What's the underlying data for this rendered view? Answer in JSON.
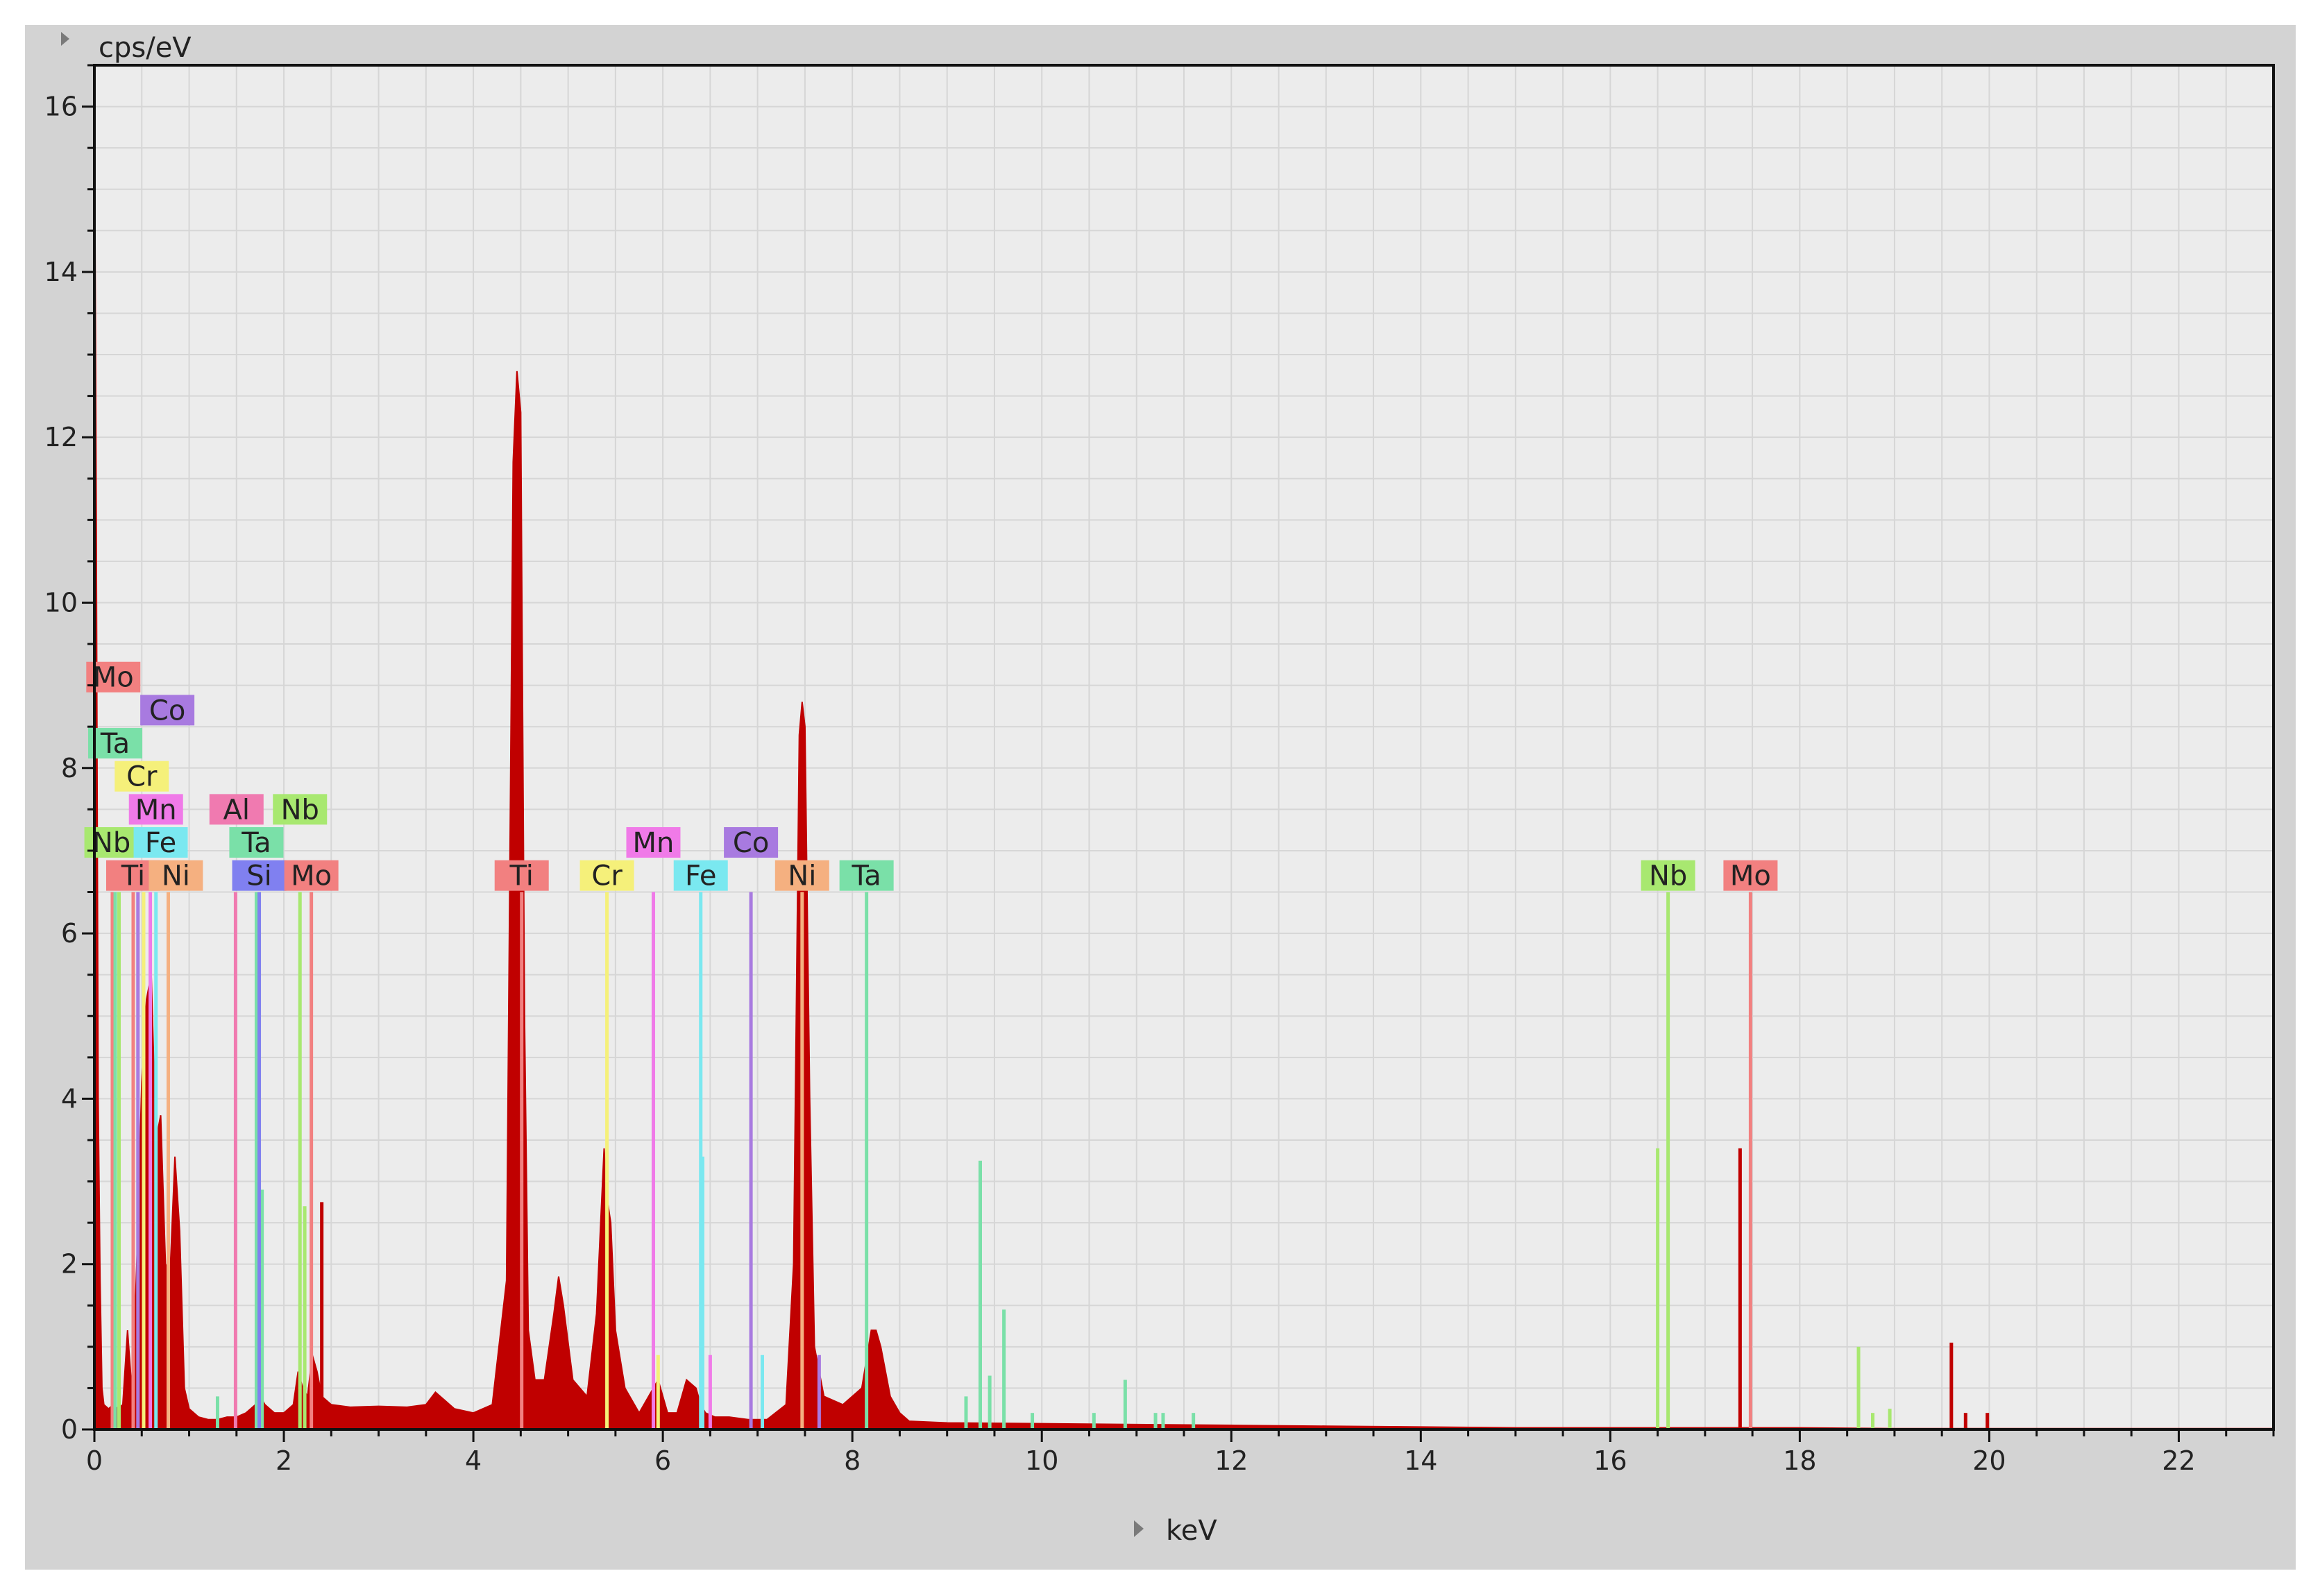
{
  "chart_data": {
    "type": "line",
    "title": "",
    "xlabel": "keV",
    "ylabel": "cps/eV",
    "xlim": [
      0,
      23
    ],
    "ylim": [
      0,
      16.5
    ],
    "x_ticks": [
      0,
      2,
      4,
      6,
      8,
      10,
      12,
      14,
      16,
      18,
      20,
      22
    ],
    "y_ticks": [
      0,
      2,
      4,
      6,
      8,
      10,
      12,
      14,
      16
    ],
    "grid": true,
    "colors": {
      "spectrum": "#c00000",
      "plot_bg": "#ececec",
      "frame_bg": "#d3d3d3",
      "grid": "#d6d6d6"
    },
    "series": [
      {
        "kind": "spectrum",
        "x": [
          0.0,
          0.02,
          0.04,
          0.06,
          0.08,
          0.1,
          0.15,
          0.2,
          0.25,
          0.3,
          0.35,
          0.4,
          0.45,
          0.5,
          0.55,
          0.6,
          0.65,
          0.7,
          0.75,
          0.8,
          0.85,
          0.9,
          0.95,
          1.0,
          1.1,
          1.2,
          1.3,
          1.4,
          1.5,
          1.6,
          1.7,
          1.75,
          1.8,
          1.9,
          2.0,
          2.1,
          2.15,
          2.2,
          2.25,
          2.3,
          2.35,
          2.4,
          2.5,
          2.7,
          3.0,
          3.3,
          3.5,
          3.6,
          3.7,
          3.8,
          4.0,
          4.2,
          4.35,
          4.42,
          4.46,
          4.5,
          4.54,
          4.58,
          4.65,
          4.75,
          4.85,
          4.9,
          4.95,
          5.05,
          5.2,
          5.3,
          5.38,
          5.41,
          5.45,
          5.5,
          5.6,
          5.75,
          5.85,
          5.95,
          6.05,
          6.15,
          6.25,
          6.35,
          6.4,
          6.45,
          6.55,
          6.7,
          6.9,
          7.1,
          7.3,
          7.38,
          7.44,
          7.47,
          7.5,
          7.55,
          7.6,
          7.7,
          7.9,
          8.1,
          8.2,
          8.25,
          8.3,
          8.4,
          8.5,
          8.6,
          9.0,
          10.0,
          11.0,
          12.0,
          13.0,
          14.0,
          15.0,
          16.0,
          17.0,
          18.0,
          19.0,
          20.0,
          21.0,
          22.0,
          23.0
        ],
        "y": [
          16.3,
          11.0,
          4.0,
          1.8,
          0.5,
          0.3,
          0.25,
          0.3,
          0.25,
          0.3,
          1.2,
          0.4,
          2.1,
          4.2,
          5.2,
          5.5,
          3.5,
          3.8,
          2.0,
          1.9,
          3.3,
          2.4,
          0.5,
          0.25,
          0.15,
          0.12,
          0.12,
          0.15,
          0.15,
          0.2,
          0.3,
          0.4,
          0.3,
          0.2,
          0.2,
          0.3,
          0.7,
          0.5,
          0.4,
          0.9,
          0.7,
          0.4,
          0.3,
          0.27,
          0.28,
          0.27,
          0.3,
          0.45,
          0.35,
          0.25,
          0.2,
          0.3,
          1.8,
          11.7,
          12.8,
          12.3,
          5.0,
          1.2,
          0.6,
          0.6,
          1.4,
          1.85,
          1.5,
          0.6,
          0.4,
          1.4,
          3.4,
          2.8,
          2.5,
          1.2,
          0.5,
          0.2,
          0.4,
          0.6,
          0.2,
          0.2,
          0.6,
          0.5,
          0.3,
          0.2,
          0.15,
          0.15,
          0.12,
          0.12,
          0.3,
          2.0,
          8.4,
          8.8,
          8.5,
          4.0,
          1.0,
          0.4,
          0.3,
          0.5,
          1.2,
          1.2,
          1.0,
          0.4,
          0.2,
          0.1,
          0.08,
          0.07,
          0.06,
          0.05,
          0.04,
          0.03,
          0.02,
          0.02,
          0.02,
          0.02,
          0.01,
          0.01,
          0.01,
          0.01,
          0.01
        ]
      }
    ],
    "element_markers": [
      {
        "label": "Mo",
        "x": 0.19,
        "height": 6.5,
        "row": 0,
        "color": "#f28080"
      },
      {
        "label": "Ta",
        "x": 0.22,
        "height": 6.5,
        "row": 0,
        "color": "#7ae0a8"
      },
      {
        "label": "Nb",
        "x": 0.26,
        "height": 6.5,
        "row": 0,
        "color": "#a8e870"
      },
      {
        "label": "Ti",
        "x": 0.41,
        "height": 6.5,
        "row": 0,
        "color": "#f28080"
      },
      {
        "label": "Co",
        "x": 0.46,
        "height": 6.5,
        "row": 0,
        "color": "#a87ae0"
      },
      {
        "label": "Cr",
        "x": 0.52,
        "height": 6.5,
        "row": 0,
        "color": "#f5f07a"
      },
      {
        "label": "Mn",
        "x": 0.59,
        "height": 6.5,
        "row": 0,
        "color": "#f07ae8"
      },
      {
        "label": "Fe",
        "x": 0.65,
        "height": 6.5,
        "row": 0,
        "color": "#7ae8f0"
      },
      {
        "label": "Ni",
        "x": 0.78,
        "height": 6.5,
        "row": 0,
        "color": "#f5b080"
      },
      {
        "label": "Al",
        "x": 1.49,
        "height": 6.5,
        "row": 0,
        "color": "#f07ab0"
      },
      {
        "label": "Ta",
        "x": 1.71,
        "height": 6.5,
        "row": 0,
        "color": "#7ae0a8"
      },
      {
        "label": "Si",
        "x": 1.74,
        "height": 6.5,
        "row": 0,
        "color": "#8080f0"
      },
      {
        "label": "Nb",
        "x": 2.17,
        "height": 6.5,
        "row": 0,
        "color": "#a8e870"
      },
      {
        "label": "Mo",
        "x": 2.29,
        "height": 6.5,
        "row": 0,
        "color": "#f28080"
      },
      {
        "label": "Ti",
        "x": 4.51,
        "height": 6.5,
        "row": 0,
        "color": "#f28080"
      },
      {
        "label": "Cr",
        "x": 5.41,
        "height": 6.5,
        "row": 0,
        "color": "#f5f07a"
      },
      {
        "label": "Mn",
        "x": 5.9,
        "height": 6.5,
        "row": 0,
        "color": "#f07ae8"
      },
      {
        "label": "Fe",
        "x": 6.4,
        "height": 6.5,
        "row": 0,
        "color": "#7ae8f0"
      },
      {
        "label": "Co",
        "x": 6.93,
        "height": 6.5,
        "row": 0,
        "color": "#a87ae0"
      },
      {
        "label": "Ni",
        "x": 7.47,
        "height": 6.5,
        "row": 0,
        "color": "#f5b080"
      },
      {
        "label": "Ta",
        "x": 8.15,
        "height": 6.5,
        "row": 0,
        "color": "#7ae0a8"
      },
      {
        "label": "Nb",
        "x": 16.61,
        "height": 6.5,
        "row": 0,
        "color": "#a8e870"
      },
      {
        "label": "Mo",
        "x": 17.48,
        "height": 6.5,
        "row": 0,
        "color": "#f28080"
      }
    ],
    "label_boxes": [
      {
        "label": "Mo",
        "x": 0.2,
        "y": 9.1,
        "color": "#f28080"
      },
      {
        "label": "Co",
        "x": 0.77,
        "y": 8.7,
        "color": "#a87ae0"
      },
      {
        "label": "Ta",
        "x": 0.22,
        "y": 8.3,
        "color": "#7ae0a8"
      },
      {
        "label": "Cr",
        "x": 0.5,
        "y": 7.9,
        "color": "#f5f07a"
      },
      {
        "label": "Mn",
        "x": 0.65,
        "y": 7.5,
        "color": "#f07ae8"
      },
      {
        "label": "Al",
        "x": 1.5,
        "y": 7.5,
        "color": "#f07ab0"
      },
      {
        "label": "Nb",
        "x": 2.17,
        "y": 7.5,
        "color": "#a8e870"
      },
      {
        "label": "Nb",
        "x": 0.18,
        "y": 7.1,
        "color": "#a8e870"
      },
      {
        "label": "Fe",
        "x": 0.7,
        "y": 7.1,
        "color": "#7ae8f0"
      },
      {
        "label": "Ta",
        "x": 1.71,
        "y": 7.1,
        "color": "#7ae0a8"
      },
      {
        "label": "Ti",
        "x": 0.41,
        "y": 6.7,
        "color": "#f28080"
      },
      {
        "label": "Ni",
        "x": 0.86,
        "y": 6.7,
        "color": "#f5b080"
      },
      {
        "label": "Si",
        "x": 1.74,
        "y": 6.7,
        "color": "#8080f0"
      },
      {
        "label": "Mo",
        "x": 2.29,
        "y": 6.7,
        "color": "#f28080"
      },
      {
        "label": "Ti",
        "x": 4.51,
        "y": 6.7,
        "color": "#f28080"
      },
      {
        "label": "Cr",
        "x": 5.41,
        "y": 6.7,
        "color": "#f5f07a"
      },
      {
        "label": "Mn",
        "x": 5.9,
        "y": 7.1,
        "color": "#f07ae8"
      },
      {
        "label": "Fe",
        "x": 6.4,
        "y": 6.7,
        "color": "#7ae8f0"
      },
      {
        "label": "Co",
        "x": 6.93,
        "y": 7.1,
        "color": "#a87ae0"
      },
      {
        "label": "Ni",
        "x": 7.47,
        "y": 6.7,
        "color": "#f5b080"
      },
      {
        "label": "Ta",
        "x": 8.15,
        "y": 6.7,
        "color": "#7ae0a8"
      },
      {
        "label": "Nb",
        "x": 16.61,
        "y": 6.7,
        "color": "#a8e870"
      },
      {
        "label": "Mo",
        "x": 17.48,
        "y": 6.7,
        "color": "#f28080"
      }
    ],
    "minor_lines": [
      {
        "x": 1.3,
        "height": 0.4,
        "color": "#7ae0a8"
      },
      {
        "x": 1.77,
        "height": 2.9,
        "color": "#7ae0a8"
      },
      {
        "x": 2.22,
        "height": 2.7,
        "color": "#a8e870"
      },
      {
        "x": 2.4,
        "height": 2.75,
        "color": "#c00000"
      },
      {
        "x": 5.95,
        "height": 0.9,
        "color": "#f5f07a"
      },
      {
        "x": 6.42,
        "height": 3.3,
        "color": "#7ae8f0"
      },
      {
        "x": 6.5,
        "height": 0.9,
        "color": "#f07ae8"
      },
      {
        "x": 7.05,
        "height": 0.9,
        "color": "#7ae8f0"
      },
      {
        "x": 7.65,
        "height": 0.9,
        "color": "#a87ae0"
      },
      {
        "x": 9.2,
        "height": 0.4,
        "color": "#7ae0a8"
      },
      {
        "x": 9.35,
        "height": 3.25,
        "color": "#7ae0a8"
      },
      {
        "x": 9.45,
        "height": 0.65,
        "color": "#7ae0a8"
      },
      {
        "x": 9.6,
        "height": 1.45,
        "color": "#7ae0a8"
      },
      {
        "x": 9.9,
        "height": 0.2,
        "color": "#7ae0a8"
      },
      {
        "x": 10.55,
        "height": 0.2,
        "color": "#7ae0a8"
      },
      {
        "x": 10.88,
        "height": 0.6,
        "color": "#7ae0a8"
      },
      {
        "x": 11.2,
        "height": 0.2,
        "color": "#7ae0a8"
      },
      {
        "x": 11.28,
        "height": 0.2,
        "color": "#7ae0a8"
      },
      {
        "x": 11.6,
        "height": 0.2,
        "color": "#7ae0a8"
      },
      {
        "x": 16.5,
        "height": 3.4,
        "color": "#a8e870"
      },
      {
        "x": 17.37,
        "height": 3.4,
        "color": "#c00000"
      },
      {
        "x": 18.62,
        "height": 1.0,
        "color": "#a8e870"
      },
      {
        "x": 18.77,
        "height": 0.2,
        "color": "#a8e870"
      },
      {
        "x": 18.95,
        "height": 0.25,
        "color": "#a8e870"
      },
      {
        "x": 19.6,
        "height": 1.05,
        "color": "#c00000"
      },
      {
        "x": 19.75,
        "height": 0.2,
        "color": "#c00000"
      },
      {
        "x": 19.98,
        "height": 0.2,
        "color": "#c00000"
      }
    ]
  }
}
